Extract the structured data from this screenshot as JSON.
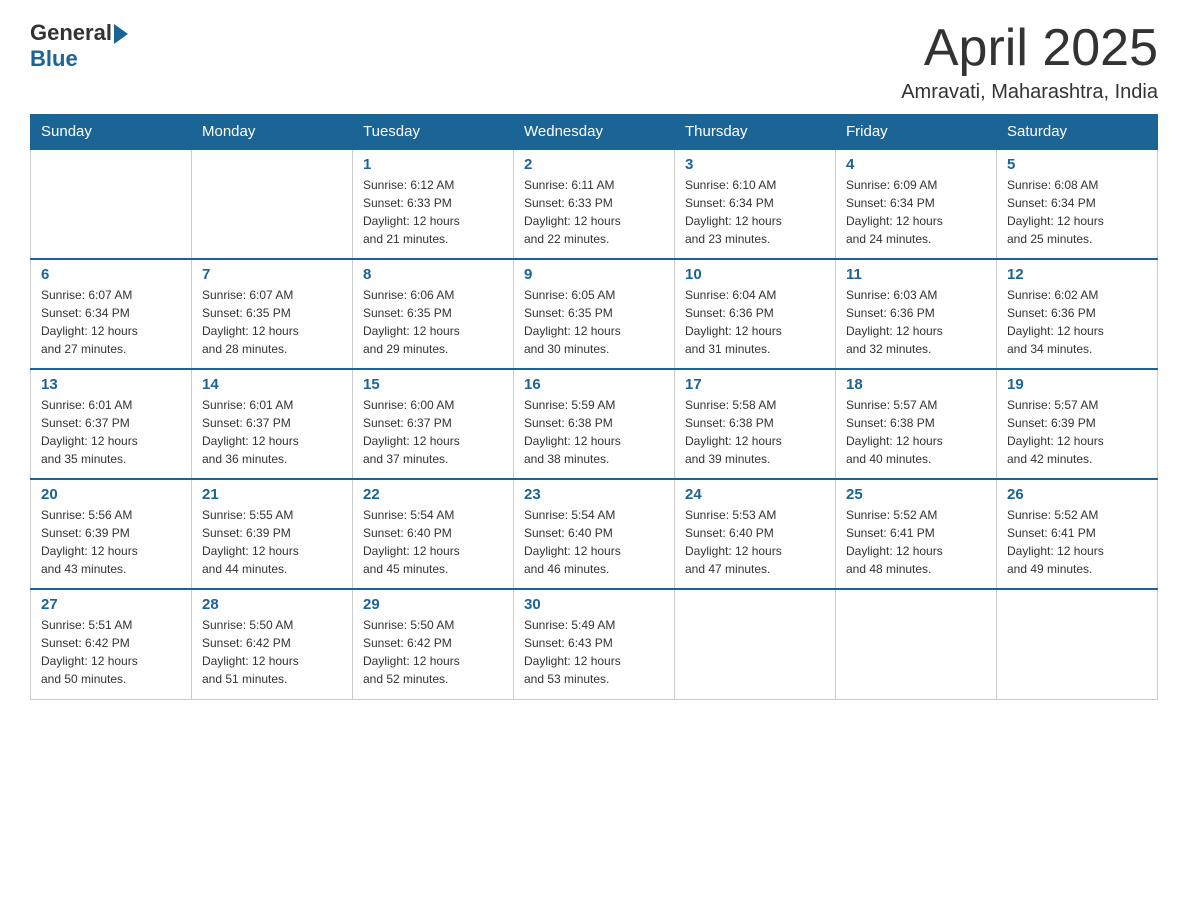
{
  "logo": {
    "text_general": "General",
    "text_blue": "Blue"
  },
  "header": {
    "title": "April 2025",
    "subtitle": "Amravati, Maharashtra, India"
  },
  "calendar": {
    "days_of_week": [
      "Sunday",
      "Monday",
      "Tuesday",
      "Wednesday",
      "Thursday",
      "Friday",
      "Saturday"
    ],
    "weeks": [
      [
        {
          "day": "",
          "info": ""
        },
        {
          "day": "",
          "info": ""
        },
        {
          "day": "1",
          "info": "Sunrise: 6:12 AM\nSunset: 6:33 PM\nDaylight: 12 hours\nand 21 minutes."
        },
        {
          "day": "2",
          "info": "Sunrise: 6:11 AM\nSunset: 6:33 PM\nDaylight: 12 hours\nand 22 minutes."
        },
        {
          "day": "3",
          "info": "Sunrise: 6:10 AM\nSunset: 6:34 PM\nDaylight: 12 hours\nand 23 minutes."
        },
        {
          "day": "4",
          "info": "Sunrise: 6:09 AM\nSunset: 6:34 PM\nDaylight: 12 hours\nand 24 minutes."
        },
        {
          "day": "5",
          "info": "Sunrise: 6:08 AM\nSunset: 6:34 PM\nDaylight: 12 hours\nand 25 minutes."
        }
      ],
      [
        {
          "day": "6",
          "info": "Sunrise: 6:07 AM\nSunset: 6:34 PM\nDaylight: 12 hours\nand 27 minutes."
        },
        {
          "day": "7",
          "info": "Sunrise: 6:07 AM\nSunset: 6:35 PM\nDaylight: 12 hours\nand 28 minutes."
        },
        {
          "day": "8",
          "info": "Sunrise: 6:06 AM\nSunset: 6:35 PM\nDaylight: 12 hours\nand 29 minutes."
        },
        {
          "day": "9",
          "info": "Sunrise: 6:05 AM\nSunset: 6:35 PM\nDaylight: 12 hours\nand 30 minutes."
        },
        {
          "day": "10",
          "info": "Sunrise: 6:04 AM\nSunset: 6:36 PM\nDaylight: 12 hours\nand 31 minutes."
        },
        {
          "day": "11",
          "info": "Sunrise: 6:03 AM\nSunset: 6:36 PM\nDaylight: 12 hours\nand 32 minutes."
        },
        {
          "day": "12",
          "info": "Sunrise: 6:02 AM\nSunset: 6:36 PM\nDaylight: 12 hours\nand 34 minutes."
        }
      ],
      [
        {
          "day": "13",
          "info": "Sunrise: 6:01 AM\nSunset: 6:37 PM\nDaylight: 12 hours\nand 35 minutes."
        },
        {
          "day": "14",
          "info": "Sunrise: 6:01 AM\nSunset: 6:37 PM\nDaylight: 12 hours\nand 36 minutes."
        },
        {
          "day": "15",
          "info": "Sunrise: 6:00 AM\nSunset: 6:37 PM\nDaylight: 12 hours\nand 37 minutes."
        },
        {
          "day": "16",
          "info": "Sunrise: 5:59 AM\nSunset: 6:38 PM\nDaylight: 12 hours\nand 38 minutes."
        },
        {
          "day": "17",
          "info": "Sunrise: 5:58 AM\nSunset: 6:38 PM\nDaylight: 12 hours\nand 39 minutes."
        },
        {
          "day": "18",
          "info": "Sunrise: 5:57 AM\nSunset: 6:38 PM\nDaylight: 12 hours\nand 40 minutes."
        },
        {
          "day": "19",
          "info": "Sunrise: 5:57 AM\nSunset: 6:39 PM\nDaylight: 12 hours\nand 42 minutes."
        }
      ],
      [
        {
          "day": "20",
          "info": "Sunrise: 5:56 AM\nSunset: 6:39 PM\nDaylight: 12 hours\nand 43 minutes."
        },
        {
          "day": "21",
          "info": "Sunrise: 5:55 AM\nSunset: 6:39 PM\nDaylight: 12 hours\nand 44 minutes."
        },
        {
          "day": "22",
          "info": "Sunrise: 5:54 AM\nSunset: 6:40 PM\nDaylight: 12 hours\nand 45 minutes."
        },
        {
          "day": "23",
          "info": "Sunrise: 5:54 AM\nSunset: 6:40 PM\nDaylight: 12 hours\nand 46 minutes."
        },
        {
          "day": "24",
          "info": "Sunrise: 5:53 AM\nSunset: 6:40 PM\nDaylight: 12 hours\nand 47 minutes."
        },
        {
          "day": "25",
          "info": "Sunrise: 5:52 AM\nSunset: 6:41 PM\nDaylight: 12 hours\nand 48 minutes."
        },
        {
          "day": "26",
          "info": "Sunrise: 5:52 AM\nSunset: 6:41 PM\nDaylight: 12 hours\nand 49 minutes."
        }
      ],
      [
        {
          "day": "27",
          "info": "Sunrise: 5:51 AM\nSunset: 6:42 PM\nDaylight: 12 hours\nand 50 minutes."
        },
        {
          "day": "28",
          "info": "Sunrise: 5:50 AM\nSunset: 6:42 PM\nDaylight: 12 hours\nand 51 minutes."
        },
        {
          "day": "29",
          "info": "Sunrise: 5:50 AM\nSunset: 6:42 PM\nDaylight: 12 hours\nand 52 minutes."
        },
        {
          "day": "30",
          "info": "Sunrise: 5:49 AM\nSunset: 6:43 PM\nDaylight: 12 hours\nand 53 minutes."
        },
        {
          "day": "",
          "info": ""
        },
        {
          "day": "",
          "info": ""
        },
        {
          "day": "",
          "info": ""
        }
      ]
    ]
  }
}
